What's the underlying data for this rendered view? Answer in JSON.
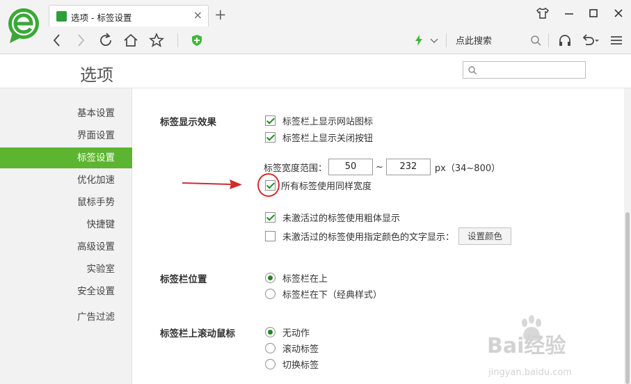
{
  "browser": {
    "tab_title": "选项 - 标签设置",
    "tab_close": "×",
    "new_tab": "+",
    "search_label": "点此搜索"
  },
  "options": {
    "title": "选项",
    "search_placeholder": ""
  },
  "sidebar": {
    "items": [
      {
        "label": "基本设置",
        "active": false
      },
      {
        "label": "界面设置",
        "active": false
      },
      {
        "label": "标签设置",
        "active": true
      },
      {
        "label": "优化加速",
        "active": false
      },
      {
        "label": "鼠标手势",
        "active": false
      },
      {
        "label": "快捷键",
        "active": false
      },
      {
        "label": "高级设置",
        "active": false
      },
      {
        "label": "实验室",
        "active": false
      },
      {
        "label": "安全设置",
        "active": false
      },
      {
        "label": "广告过滤",
        "active": false
      }
    ]
  },
  "tab_display": {
    "label": "标签显示效果",
    "show_site_icon": {
      "label": "标签栏上显示网站图标",
      "checked": true
    },
    "show_close_button": {
      "label": "标签栏上显示关闭按钮",
      "checked": true
    },
    "width_range_label": "标签宽度范围：",
    "width_min": "50",
    "width_sep": "~",
    "width_max": "232",
    "width_unit": "px（34~800）",
    "same_width": {
      "label": "所有标签使用同样宽度",
      "checked": true
    },
    "bold_inactive": {
      "label": "未激活过的标签使用粗体显示",
      "checked": true
    },
    "color_inactive": {
      "label": "未激活过的标签使用指定颜色的文字显示：",
      "checked": false
    },
    "set_color_button": "设置颜色"
  },
  "tab_position": {
    "label": "标签栏位置",
    "options": [
      {
        "label": "标签栏在上",
        "checked": true
      },
      {
        "label": "标签栏在下（经典样式）",
        "checked": false
      }
    ]
  },
  "tab_scroll": {
    "label": "标签栏上滚动鼠标",
    "options": [
      {
        "label": "无动作",
        "checked": true
      },
      {
        "label": "滚动标签",
        "checked": false
      },
      {
        "label": "切换标签",
        "checked": false
      }
    ]
  },
  "watermark": {
    "brand": "Bai经验",
    "url": "jingyan.baidu.com"
  },
  "colors": {
    "accent": "#5cb531",
    "check": "#1e8a1e",
    "annotation": "#d42a2a"
  }
}
